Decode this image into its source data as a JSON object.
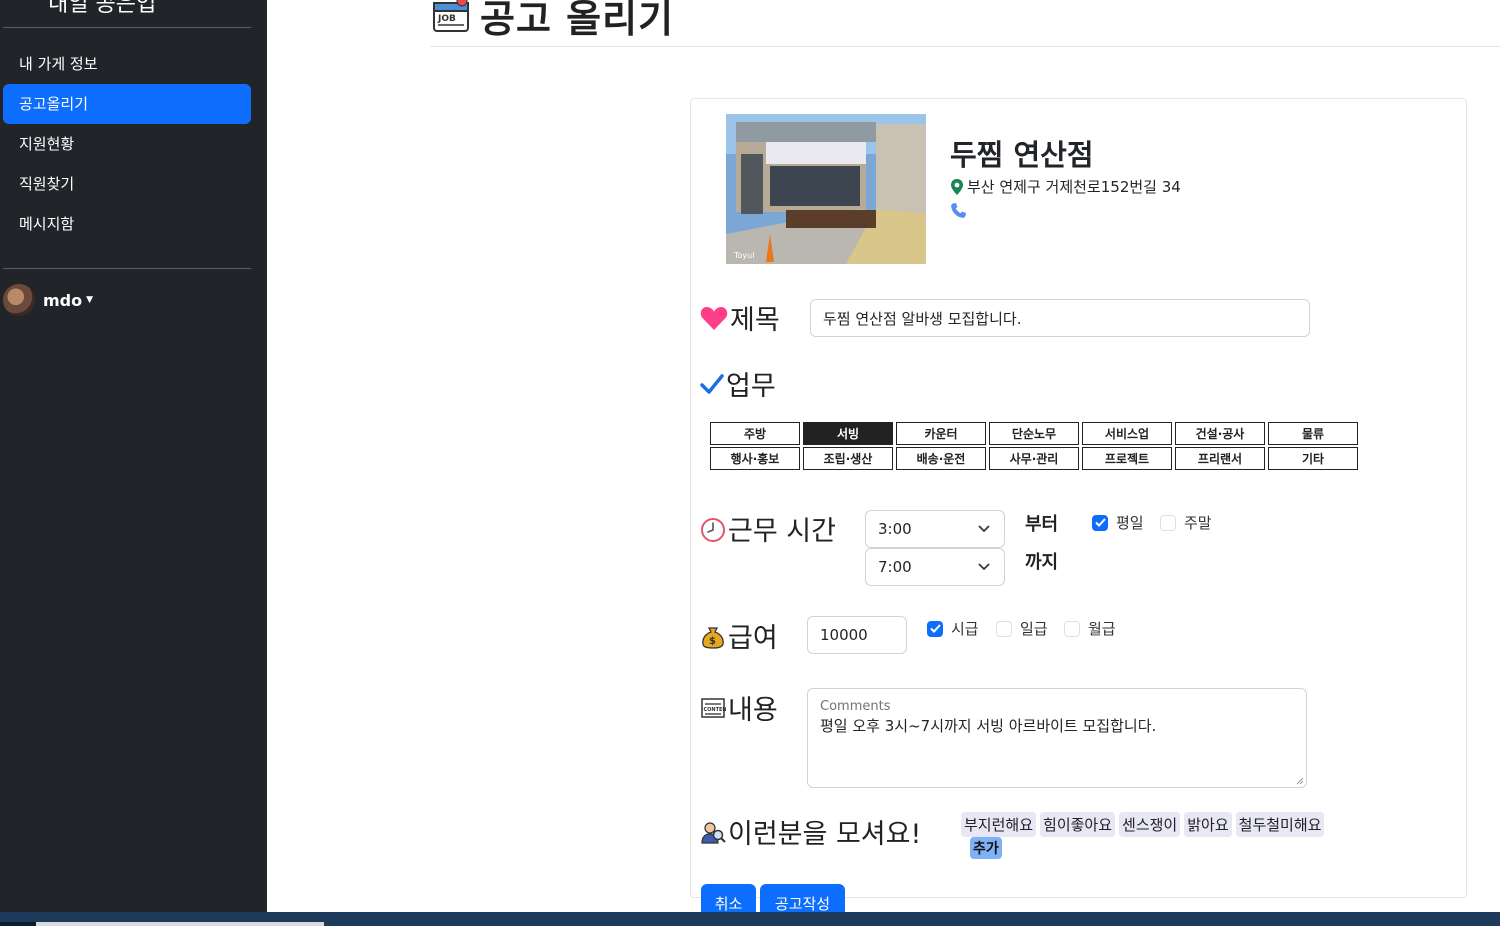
{
  "sidebar": {
    "brand": "내일 공은업",
    "nav": [
      "내 가게 정보",
      "공고올리기",
      "지원현황",
      "직원찾기",
      "메시지함"
    ],
    "active_index": 1,
    "user": "mdo"
  },
  "page": {
    "title": "공고 올리기"
  },
  "store": {
    "name": "두찜 연산점",
    "address": "부산 연제구 거제천로152번길 34"
  },
  "form": {
    "title_label": "제목",
    "title_value": "두찜 연산점 알바생 모집합니다.",
    "job_label": "업무",
    "jobs": [
      "주방",
      "서빙",
      "카운터",
      "단순노무",
      "서비스업",
      "건설·공사",
      "물류",
      "행사·홍보",
      "조립·생산",
      "배송·운전",
      "사무·관리",
      "프로젝트",
      "프리랜서",
      "기타"
    ],
    "selected_job": "서빙",
    "time_label": "근무 시간",
    "time_from": "3:00",
    "time_to": "7:00",
    "from_label": "부터",
    "to_label": "까지",
    "weekday_label": "평일",
    "weekend_label": "주말",
    "weekday_checked": true,
    "weekend_checked": false,
    "pay_label": "급여",
    "pay_value": "10000",
    "hourly_label": "시급",
    "daily_label": "일급",
    "monthly_label": "월급",
    "hourly_checked": true,
    "daily_checked": false,
    "monthly_checked": false,
    "content_label": "내용",
    "comments_label": "Comments",
    "comments_value": "평일 오후 3시~7시까지 서빙 아르바이트 모집합니다.",
    "wanted_label": "이런분을 모셔요!",
    "tags": [
      "부지런해요",
      "힘이좋아요",
      "센스쟁이",
      "밝아요",
      "철두철미해요"
    ],
    "tag_add": "추가",
    "cancel_button": "취소",
    "submit_button": "공고작성"
  },
  "colors": {
    "sidebar_bg": "#212529",
    "accent": "#0d6efd",
    "heart": "#ff3e8a"
  },
  "icons": [
    "job-board-icon",
    "map-pin-icon",
    "phone-icon",
    "heart-icon",
    "check-icon",
    "clock-icon",
    "money-bag-icon",
    "content-icon",
    "recruiter-icon"
  ]
}
